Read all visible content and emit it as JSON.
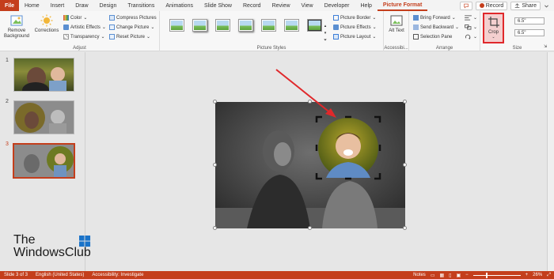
{
  "tabs": [
    "File",
    "Home",
    "Insert",
    "Draw",
    "Design",
    "Transitions",
    "Animations",
    "Slide Show",
    "Record",
    "Review",
    "View",
    "Developer",
    "Help",
    "Picture Format"
  ],
  "active_tab": "Picture Format",
  "top_right": {
    "record_label": "Record",
    "share_label": "Share"
  },
  "ribbon": {
    "adjust": {
      "label": "Adjust",
      "remove_background": "Remove Background",
      "corrections": "Corrections",
      "color": "Color",
      "artistic_effects": "Artistic Effects",
      "transparency": "Transparency",
      "compress_pictures": "Compress Pictures",
      "change_picture": "Change Picture",
      "reset_picture": "Reset Picture"
    },
    "picture_styles": {
      "label": "Picture Styles",
      "picture_border": "Picture Border",
      "picture_effects": "Picture Effects",
      "picture_layout": "Picture Layout"
    },
    "accessibility": {
      "label": "Accessibi...",
      "alt_text": "Alt Text"
    },
    "arrange": {
      "label": "Arrange",
      "bring_forward": "Bring Forward",
      "send_backward": "Send Backward",
      "selection_pane": "Selection Pane"
    },
    "size": {
      "label": "Size",
      "crop": "Crop",
      "height": "6.5\"",
      "width": "6.5\""
    }
  },
  "slides": [
    {
      "number": "1"
    },
    {
      "number": "2"
    },
    {
      "number": "3"
    }
  ],
  "logo": {
    "line1": "The",
    "line2": "WindowsClub"
  },
  "status": {
    "slide": "Slide 3 of 3",
    "language": "English (United States)",
    "accessibility": "Accessibility: Investigate",
    "notes": "Notes",
    "zoom": "26%"
  },
  "colors": {
    "accent": "#c43e1c",
    "highlight": "#e0282b"
  }
}
